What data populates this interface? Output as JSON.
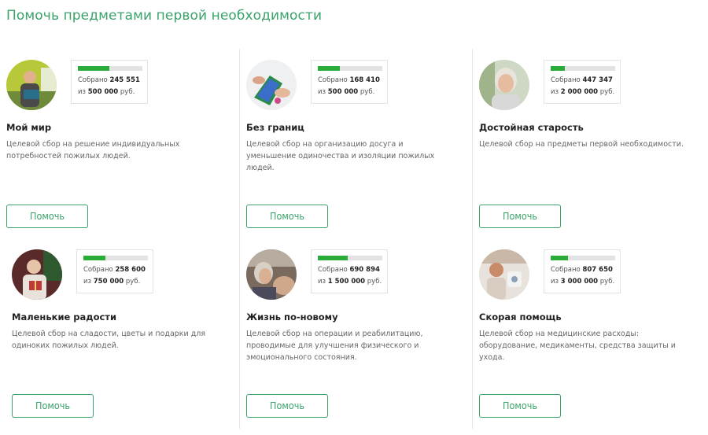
{
  "page_title": "Помочь предметами первой необходимости",
  "colors": {
    "accent": "#3aa36a",
    "progress": "#2bab3a",
    "track": "#e3e3e3"
  },
  "cards": [
    {
      "title": "Мой мир",
      "description": "Целевой сбор на решение индивидуальных потребностей пожилых людей.",
      "collected_label": "Собрано",
      "collected": "245 551",
      "goal_prefix": "из",
      "goal": "500 000",
      "currency": "руб.",
      "progress_fraction": 0.49,
      "button_label": "Помочь",
      "image": "elderly-man-with-accordion-photo"
    },
    {
      "title": "Без границ",
      "description": "Целевой сбор на организацию досуга и уменьшение одиночества и изоляции пожилых людей.",
      "collected_label": "Собрано",
      "collected": "168 410",
      "goal_prefix": "из",
      "goal": "500 000",
      "currency": "руб.",
      "progress_fraction": 0.34,
      "button_label": "Помочь",
      "image": "hands-with-tablet-photo"
    },
    {
      "title": "Достойная старость",
      "description": "Целевой сбор на предметы первой необходимости.",
      "collected_label": "Собрано",
      "collected": "447 347",
      "goal_prefix": "из",
      "goal": "2 000 000",
      "currency": "руб.",
      "progress_fraction": 0.22,
      "button_label": "Помочь",
      "image": "elderly-woman-portrait-photo"
    },
    {
      "title": "Маленькие радости",
      "description": "Целевой сбор на сладости, цветы и подарки для одиноких пожилых людей.",
      "collected_label": "Собрано",
      "collected": "258 600",
      "goal_prefix": "из",
      "goal": "750 000",
      "currency": "руб.",
      "progress_fraction": 0.34,
      "button_label": "Помочь",
      "image": "elderly-woman-with-gift-photo"
    },
    {
      "title": "Жизнь по-новому",
      "description": "Целевой сбор на операции и реабилитацию, проводимые для улучшения физического и эмоционального состояния.",
      "collected_label": "Собрано",
      "collected": "690 894",
      "goal_prefix": "из",
      "goal": "1 500 000",
      "currency": "руб.",
      "progress_fraction": 0.46,
      "button_label": "Помочь",
      "image": "elderly-woman-sad-photo"
    },
    {
      "title": "Скорая помощь",
      "description": "Целевой сбор на медицинские расходы: оборудование, медикаменты, средства защиты и ухода.",
      "collected_label": "Собрано",
      "collected": "807 650",
      "goal_prefix": "из",
      "goal": "3 000 000",
      "currency": "руб.",
      "progress_fraction": 0.27,
      "button_label": "Помочь",
      "image": "medical-checkup-photo"
    }
  ]
}
